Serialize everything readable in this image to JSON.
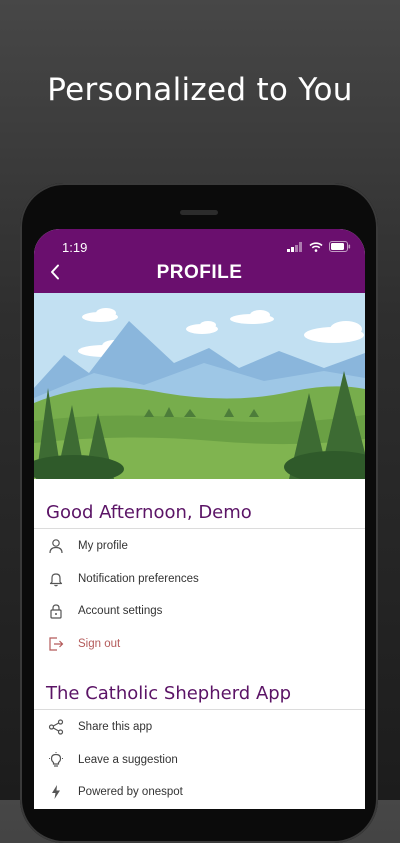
{
  "headline": "Personalized to You",
  "status_bar": {
    "time": "1:19",
    "icons": [
      "signal-icon",
      "wifi-icon",
      "battery-icon"
    ]
  },
  "header": {
    "title": "PROFILE",
    "back_icon": "chevron-left-icon",
    "background": "#6a0f6e"
  },
  "greeting": "Good Afternoon, Demo",
  "account_menu": [
    {
      "label": "My profile",
      "icon": "person-icon"
    },
    {
      "label": "Notification preferences",
      "icon": "bell-icon"
    },
    {
      "label": "Account settings",
      "icon": "lock-icon"
    },
    {
      "label": "Sign out",
      "icon": "sign-out-icon",
      "color": "#b45a5a"
    }
  ],
  "app_section_title": "The Catholic Shepherd App",
  "app_menu": [
    {
      "label": "Share this app",
      "icon": "share-icon"
    },
    {
      "label": "Leave a suggestion",
      "icon": "lightbulb-icon"
    },
    {
      "label": "Powered by onespot",
      "icon": "lightning-icon"
    }
  ],
  "colors": {
    "accent": "#6a0f6e",
    "section_title": "#5b1466",
    "sign_out": "#b45a5a"
  }
}
